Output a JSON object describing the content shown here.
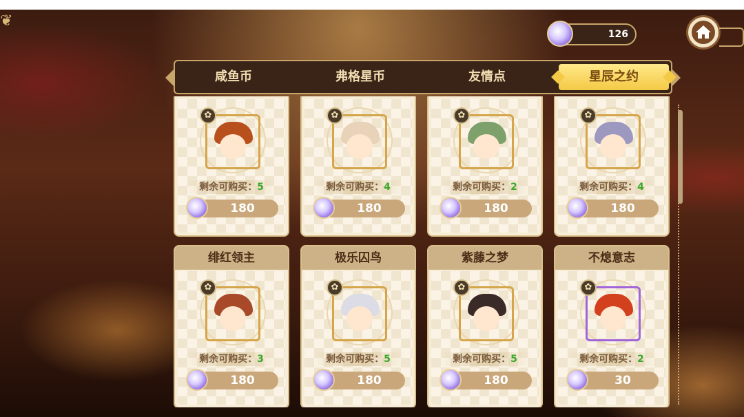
{
  "currency": {
    "amount": "126",
    "icon": "star-gem-icon"
  },
  "tabs": [
    {
      "label": "咸鱼币",
      "active": false
    },
    {
      "label": "弗格星币",
      "active": false
    },
    {
      "label": "友情点",
      "active": false
    },
    {
      "label": "星辰之约",
      "active": true
    }
  ],
  "remain_label": "剩余可购买：",
  "items": [
    {
      "name": "",
      "remain": "5",
      "price": "180",
      "hair": "#b8501e",
      "frame": "gold"
    },
    {
      "name": "",
      "remain": "4",
      "price": "180",
      "hair": "#e8d2b8",
      "frame": "gold"
    },
    {
      "name": "",
      "remain": "2",
      "price": "180",
      "hair": "#7ea06a",
      "frame": "gold"
    },
    {
      "name": "",
      "remain": "4",
      "price": "180",
      "hair": "#9c98c0",
      "frame": "gold"
    },
    {
      "name": "绯红领主",
      "remain": "3",
      "price": "180",
      "hair": "#a84a2a",
      "frame": "gold"
    },
    {
      "name": "极乐囚鸟",
      "remain": "5",
      "price": "180",
      "hair": "#dcdce6",
      "frame": "gold"
    },
    {
      "name": "紫藤之梦",
      "remain": "5",
      "price": "180",
      "hair": "#3a2a28",
      "frame": "gold"
    },
    {
      "name": "不熄意志",
      "remain": "2",
      "price": "30",
      "hair": "#d2401e",
      "frame": "purple"
    }
  ]
}
